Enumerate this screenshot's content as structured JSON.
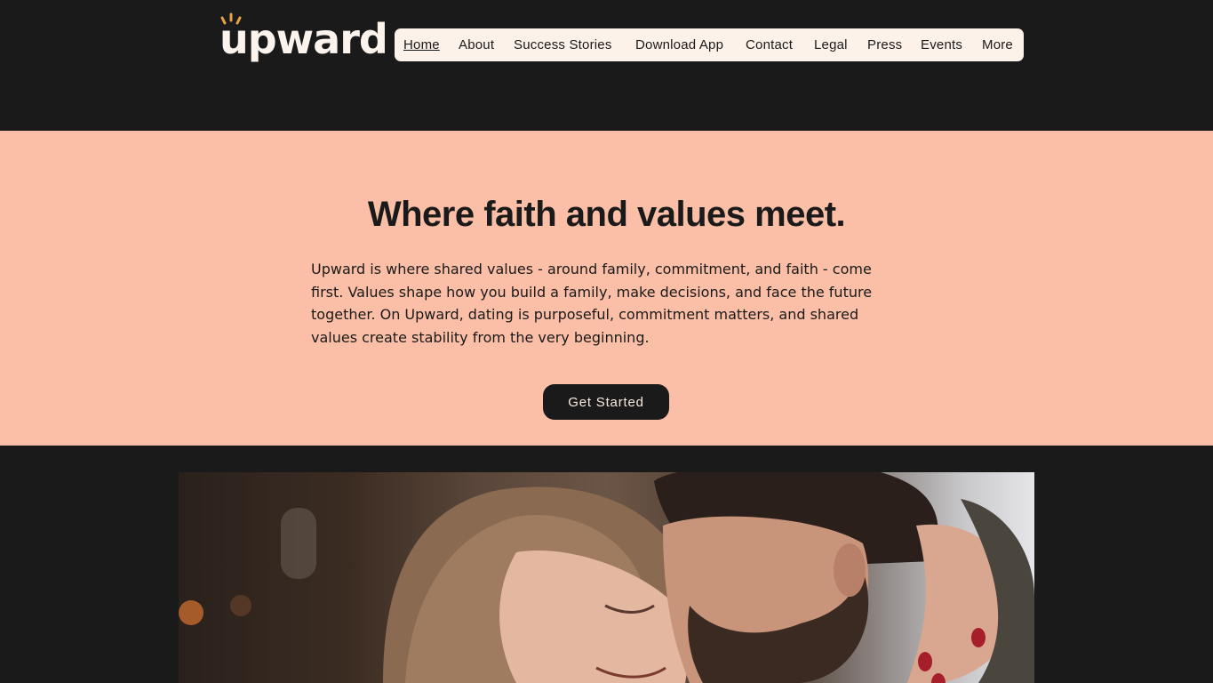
{
  "brand": {
    "logo_text": "upward",
    "logo_icon": "sunrise-rays-icon",
    "accent_color": "#e8a04a"
  },
  "nav": {
    "items": [
      {
        "label": "Home",
        "active": true
      },
      {
        "label": "About"
      },
      {
        "label": "Success Stories"
      },
      {
        "label": "Download App"
      },
      {
        "label": "Contact"
      },
      {
        "label": "Legal"
      },
      {
        "label": "Press"
      },
      {
        "label": "Events"
      },
      {
        "label": "More"
      }
    ]
  },
  "hero": {
    "title": "Where faith and values meet.",
    "body": "Upward is where shared values - around family, commitment, and faith - come first. Values shape how you build a family, make decisions, and face the future together. On Upward, dating is purposeful, commitment matters, and shared values create stability from the very beginning.",
    "cta_label": "Get Started",
    "background_color": "#fbbea6"
  },
  "photo": {
    "subject": "couple-embracing-photo"
  }
}
